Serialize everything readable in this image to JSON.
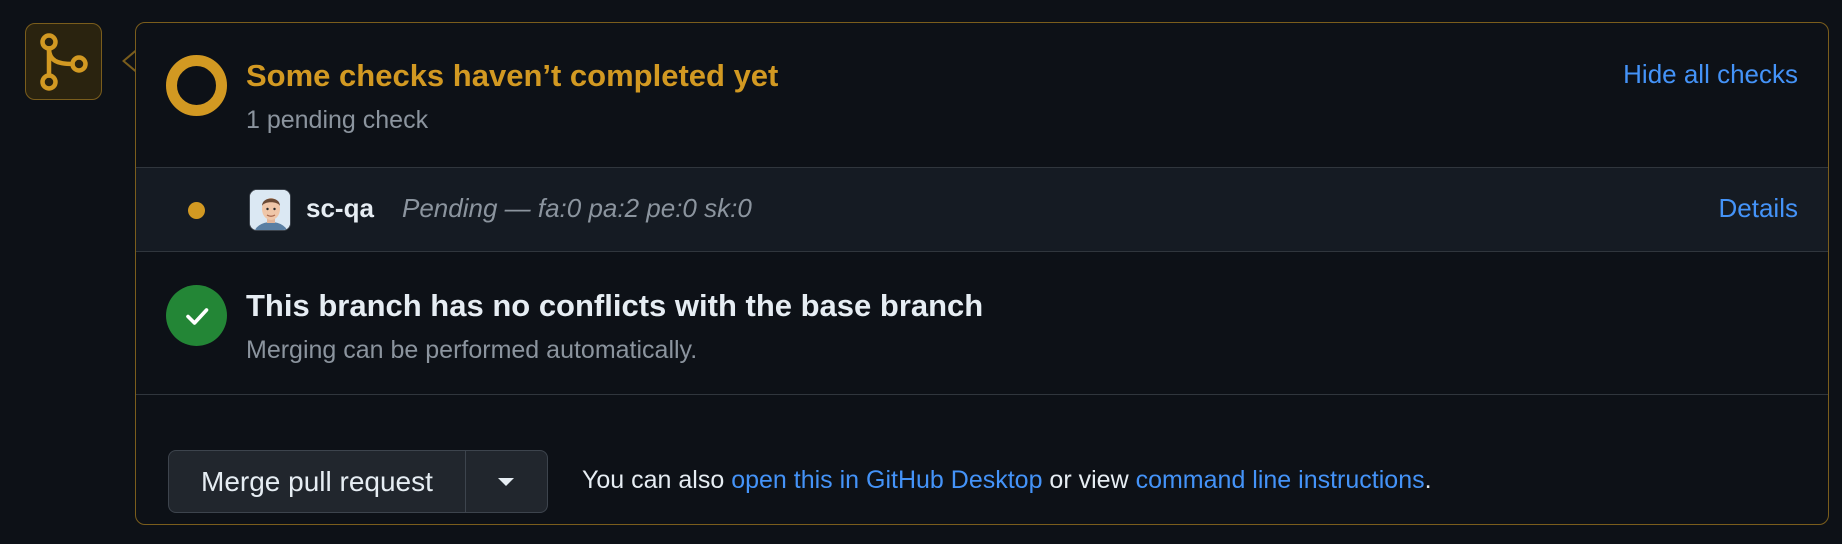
{
  "checks": {
    "title": "Some checks haven’t completed yet",
    "subtitle": "1 pending check",
    "hide_link": "Hide all checks",
    "status_color": "#d29922",
    "items": [
      {
        "name": "sc-qa",
        "status": "Pending — fa:0 pa:2 pe:0 sk:0",
        "details_label": "Details",
        "status_icon": "pending-dot-icon",
        "avatar_icon": "avatar-icon"
      }
    ]
  },
  "conflicts": {
    "title": "This branch has no conflicts with the base branch",
    "subtitle": "Merging can be performed automatically.",
    "icon": "check-icon",
    "icon_color": "#238636"
  },
  "merge": {
    "button_label": "Merge pull request",
    "dropdown_icon": "caret-down-icon",
    "hint_prefix": "You can also ",
    "hint_link_desktop": "open this in GitHub Desktop",
    "hint_middle": " or view ",
    "hint_link_cli": "command line instructions",
    "hint_suffix": "."
  },
  "sidebar_icon": "git-merge-icon",
  "link_color": "#4493f8"
}
